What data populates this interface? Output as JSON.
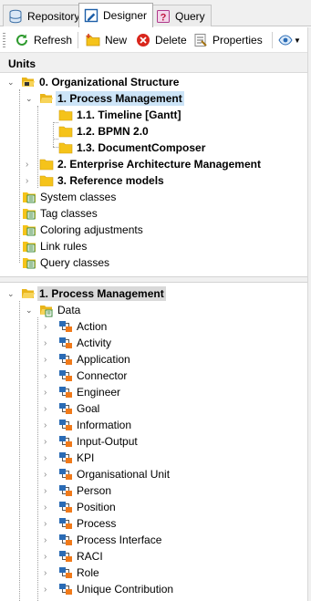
{
  "tabs": [
    {
      "label": "Repository",
      "icon": "database-icon"
    },
    {
      "label": "Designer",
      "icon": "designer-icon",
      "active": true
    },
    {
      "label": "Query",
      "icon": "query-icon"
    }
  ],
  "toolbar": {
    "refresh_label": "Refresh",
    "new_label": "New",
    "delete_label": "Delete",
    "properties_label": "Properties"
  },
  "units_header": "Units",
  "units_tree": {
    "root": "0. Organizational Structure",
    "process_management": "1. Process Management",
    "timeline": "1.1. Timeline [Gantt]",
    "bpmn": "1.2. BPMN 2.0",
    "document_composer": "1.3. DocumentComposer",
    "enterprise_architecture": "2. Enterprise Architecture Management",
    "reference_models": "3. Reference models",
    "system_classes": "System classes",
    "tag_classes": "Tag classes",
    "coloring": "Coloring adjustments",
    "link_rules": "Link rules",
    "query_classes": "Query classes"
  },
  "detail_tree": {
    "root": "1. Process Management",
    "data": "Data",
    "items": [
      "Action",
      "Activity",
      "Application",
      "Connector",
      "Engineer",
      "Goal",
      "Information",
      "Input-Output",
      "KPI",
      "Organisational Unit",
      "Person",
      "Position",
      "Process",
      "Process Interface",
      "RACI",
      "Role",
      "Unique Contribution"
    ]
  },
  "colors": {
    "folder": "#f5c31a",
    "selection": "#cce4f7",
    "accent": "#1e74c8",
    "delete_red": "#d9261c"
  }
}
